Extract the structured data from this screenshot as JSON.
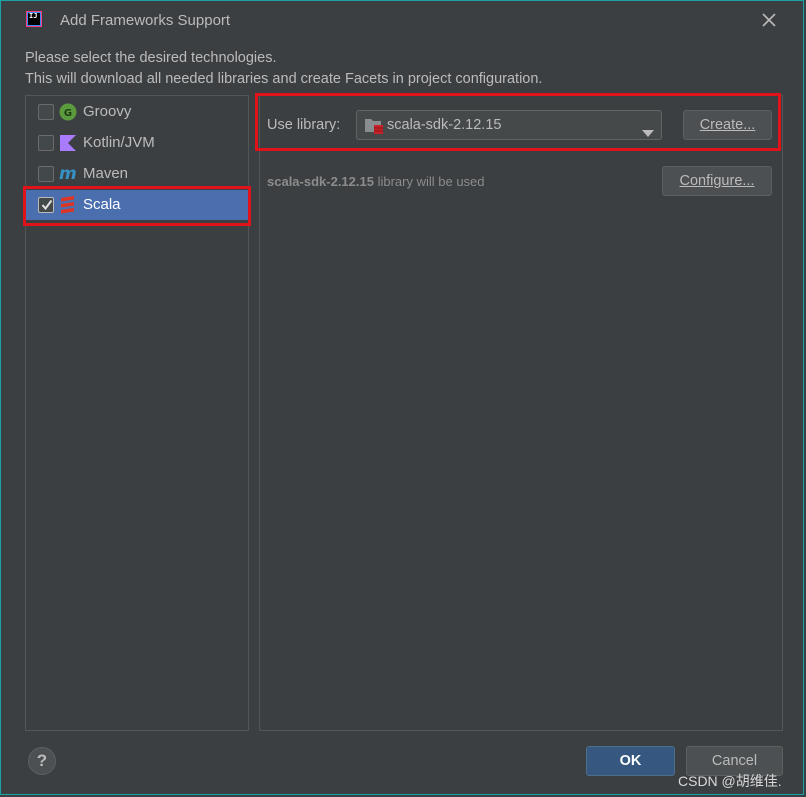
{
  "window": {
    "title": "Add Frameworks Support",
    "intro_line1": "Please select the desired technologies.",
    "intro_line2": "This will download all needed libraries and create Facets in project configuration."
  },
  "frameworks": [
    {
      "label": "Groovy",
      "checked": false,
      "selected": false,
      "icon": "groovy-icon"
    },
    {
      "label": "Kotlin/JVM",
      "checked": false,
      "selected": false,
      "icon": "kotlin-icon"
    },
    {
      "label": "Maven",
      "checked": false,
      "selected": false,
      "icon": "maven-icon"
    },
    {
      "label": "Scala",
      "checked": true,
      "selected": true,
      "icon": "scala-icon"
    }
  ],
  "library": {
    "use_label": "Use library:",
    "selected": "scala-sdk-2.12.15",
    "create_button": "Create...",
    "configure_button": "Configure...",
    "note_name": "scala-sdk-2.12.15",
    "note_suffix": " library will be used"
  },
  "footer": {
    "help_button": "?",
    "ok_button": "OK",
    "cancel_button": "Cancel"
  },
  "watermark": "CSDN @胡维佳.",
  "colors": {
    "background": "#3c3f41",
    "selection": "#4b6eaf",
    "highlight_box": "#e0121a",
    "ok_button": "#365880"
  }
}
